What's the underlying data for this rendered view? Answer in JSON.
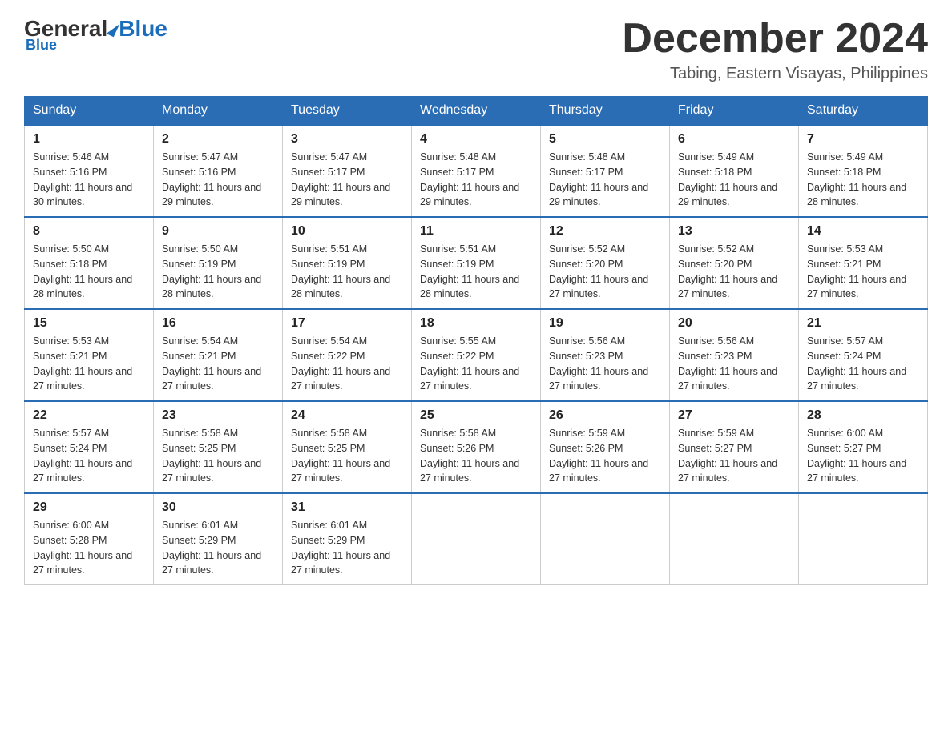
{
  "header": {
    "logo_text_general": "General",
    "logo_text_blue": "Blue",
    "month_title": "December 2024",
    "location": "Tabing, Eastern Visayas, Philippines"
  },
  "weekdays": [
    "Sunday",
    "Monday",
    "Tuesday",
    "Wednesday",
    "Thursday",
    "Friday",
    "Saturday"
  ],
  "weeks": [
    [
      {
        "day": "1",
        "sunrise": "5:46 AM",
        "sunset": "5:16 PM",
        "daylight": "11 hours and 30 minutes."
      },
      {
        "day": "2",
        "sunrise": "5:47 AM",
        "sunset": "5:16 PM",
        "daylight": "11 hours and 29 minutes."
      },
      {
        "day": "3",
        "sunrise": "5:47 AM",
        "sunset": "5:17 PM",
        "daylight": "11 hours and 29 minutes."
      },
      {
        "day": "4",
        "sunrise": "5:48 AM",
        "sunset": "5:17 PM",
        "daylight": "11 hours and 29 minutes."
      },
      {
        "day": "5",
        "sunrise": "5:48 AM",
        "sunset": "5:17 PM",
        "daylight": "11 hours and 29 minutes."
      },
      {
        "day": "6",
        "sunrise": "5:49 AM",
        "sunset": "5:18 PM",
        "daylight": "11 hours and 29 minutes."
      },
      {
        "day": "7",
        "sunrise": "5:49 AM",
        "sunset": "5:18 PM",
        "daylight": "11 hours and 28 minutes."
      }
    ],
    [
      {
        "day": "8",
        "sunrise": "5:50 AM",
        "sunset": "5:18 PM",
        "daylight": "11 hours and 28 minutes."
      },
      {
        "day": "9",
        "sunrise": "5:50 AM",
        "sunset": "5:19 PM",
        "daylight": "11 hours and 28 minutes."
      },
      {
        "day": "10",
        "sunrise": "5:51 AM",
        "sunset": "5:19 PM",
        "daylight": "11 hours and 28 minutes."
      },
      {
        "day": "11",
        "sunrise": "5:51 AM",
        "sunset": "5:19 PM",
        "daylight": "11 hours and 28 minutes."
      },
      {
        "day": "12",
        "sunrise": "5:52 AM",
        "sunset": "5:20 PM",
        "daylight": "11 hours and 27 minutes."
      },
      {
        "day": "13",
        "sunrise": "5:52 AM",
        "sunset": "5:20 PM",
        "daylight": "11 hours and 27 minutes."
      },
      {
        "day": "14",
        "sunrise": "5:53 AM",
        "sunset": "5:21 PM",
        "daylight": "11 hours and 27 minutes."
      }
    ],
    [
      {
        "day": "15",
        "sunrise": "5:53 AM",
        "sunset": "5:21 PM",
        "daylight": "11 hours and 27 minutes."
      },
      {
        "day": "16",
        "sunrise": "5:54 AM",
        "sunset": "5:21 PM",
        "daylight": "11 hours and 27 minutes."
      },
      {
        "day": "17",
        "sunrise": "5:54 AM",
        "sunset": "5:22 PM",
        "daylight": "11 hours and 27 minutes."
      },
      {
        "day": "18",
        "sunrise": "5:55 AM",
        "sunset": "5:22 PM",
        "daylight": "11 hours and 27 minutes."
      },
      {
        "day": "19",
        "sunrise": "5:56 AM",
        "sunset": "5:23 PM",
        "daylight": "11 hours and 27 minutes."
      },
      {
        "day": "20",
        "sunrise": "5:56 AM",
        "sunset": "5:23 PM",
        "daylight": "11 hours and 27 minutes."
      },
      {
        "day": "21",
        "sunrise": "5:57 AM",
        "sunset": "5:24 PM",
        "daylight": "11 hours and 27 minutes."
      }
    ],
    [
      {
        "day": "22",
        "sunrise": "5:57 AM",
        "sunset": "5:24 PM",
        "daylight": "11 hours and 27 minutes."
      },
      {
        "day": "23",
        "sunrise": "5:58 AM",
        "sunset": "5:25 PM",
        "daylight": "11 hours and 27 minutes."
      },
      {
        "day": "24",
        "sunrise": "5:58 AM",
        "sunset": "5:25 PM",
        "daylight": "11 hours and 27 minutes."
      },
      {
        "day": "25",
        "sunrise": "5:58 AM",
        "sunset": "5:26 PM",
        "daylight": "11 hours and 27 minutes."
      },
      {
        "day": "26",
        "sunrise": "5:59 AM",
        "sunset": "5:26 PM",
        "daylight": "11 hours and 27 minutes."
      },
      {
        "day": "27",
        "sunrise": "5:59 AM",
        "sunset": "5:27 PM",
        "daylight": "11 hours and 27 minutes."
      },
      {
        "day": "28",
        "sunrise": "6:00 AM",
        "sunset": "5:27 PM",
        "daylight": "11 hours and 27 minutes."
      }
    ],
    [
      {
        "day": "29",
        "sunrise": "6:00 AM",
        "sunset": "5:28 PM",
        "daylight": "11 hours and 27 minutes."
      },
      {
        "day": "30",
        "sunrise": "6:01 AM",
        "sunset": "5:29 PM",
        "daylight": "11 hours and 27 minutes."
      },
      {
        "day": "31",
        "sunrise": "6:01 AM",
        "sunset": "5:29 PM",
        "daylight": "11 hours and 27 minutes."
      },
      null,
      null,
      null,
      null
    ]
  ]
}
